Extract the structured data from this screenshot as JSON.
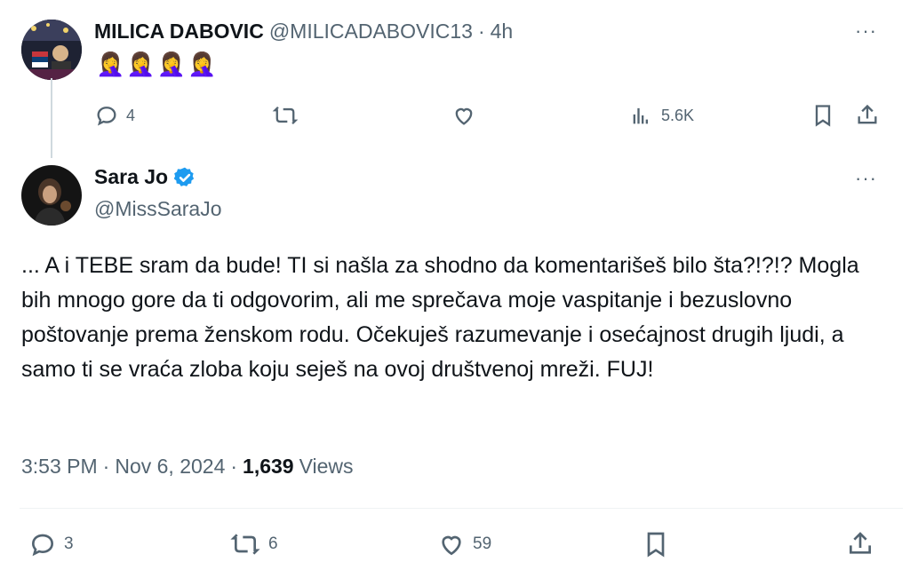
{
  "reply": {
    "display_name": "MILICA DABOVIC",
    "handle": "@MILICADABOVIC13",
    "separator": "·",
    "time": "4h",
    "content": "🤦‍♀️🤦‍♀️🤦‍♀️🤦‍♀️",
    "stats": {
      "replies": "4",
      "views": "5.6K"
    },
    "more": "···"
  },
  "main": {
    "display_name": "Sara Jo",
    "handle": "@MissSaraJo",
    "more": "···",
    "text": "... A i TEBE sram da bude! TI si našla za shodno da komentarišeš bilo šta?!?!? Mogla bih mnogo gore da ti odgovorim, ali me sprečava moje vaspitanje i bezuslovno poštovanje prema ženskom rodu. Očekuješ razumevanje i osećajnost drugih ljudi, a samo ti se vraća zloba koju seješ na ovoj društvenoj mreži. FUJ!",
    "time": "3:53 PM",
    "date": "Nov 6, 2024",
    "dot": "·",
    "views_count": "1,639",
    "views_label": "Views",
    "stats": {
      "replies": "3",
      "retweets": "6",
      "likes": "59"
    }
  },
  "colors": {
    "verified": "#1d9bf0",
    "muted": "#536471",
    "text": "#0f1419"
  },
  "icons": [
    "reply-icon",
    "retweet-icon",
    "like-icon",
    "views-icon",
    "bookmark-icon",
    "share-icon",
    "verified-badge-icon",
    "more-icon"
  ]
}
